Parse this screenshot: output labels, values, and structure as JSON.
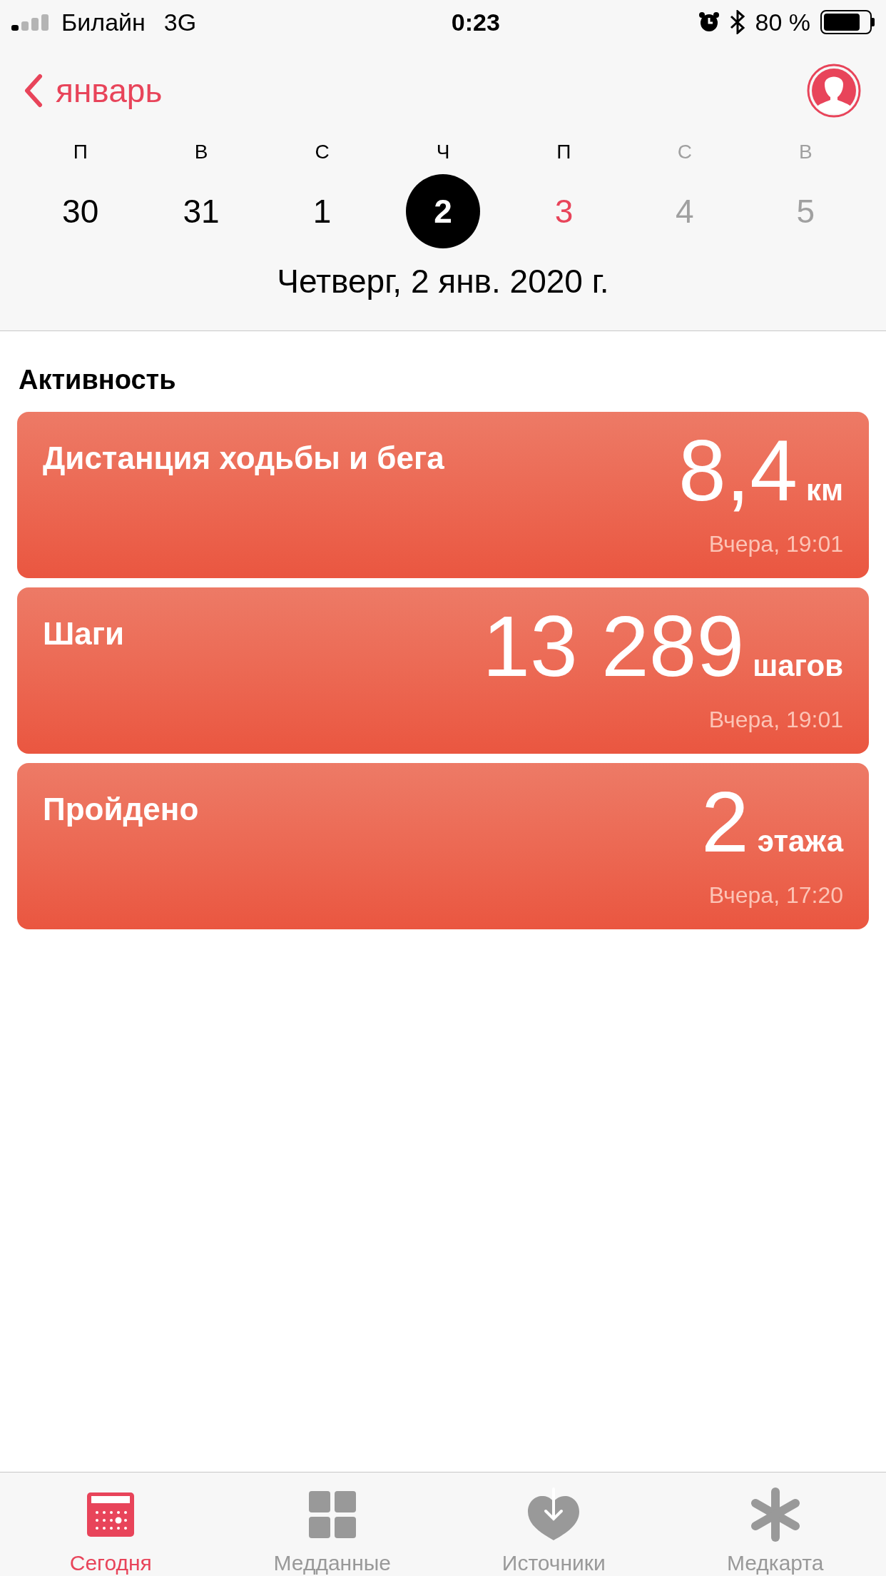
{
  "status_bar": {
    "carrier": "Билайн",
    "network": "3G",
    "time": "0:23",
    "battery_percent": "80 %"
  },
  "header": {
    "back_label": "январь"
  },
  "week": [
    {
      "weekday": "П",
      "day": "30",
      "selected": false,
      "today": false,
      "dimmed": false
    },
    {
      "weekday": "В",
      "day": "31",
      "selected": false,
      "today": false,
      "dimmed": false
    },
    {
      "weekday": "С",
      "day": "1",
      "selected": false,
      "today": false,
      "dimmed": false
    },
    {
      "weekday": "Ч",
      "day": "2",
      "selected": true,
      "today": false,
      "dimmed": false
    },
    {
      "weekday": "П",
      "day": "3",
      "selected": false,
      "today": true,
      "dimmed": false
    },
    {
      "weekday": "С",
      "day": "4",
      "selected": false,
      "today": false,
      "dimmed": true
    },
    {
      "weekday": "В",
      "day": "5",
      "selected": false,
      "today": false,
      "dimmed": true
    }
  ],
  "selected_date": "Четверг, 2 янв. 2020 г.",
  "section_title": "Активность",
  "cards": [
    {
      "title": "Дистанция ходьбы и бега",
      "value": "8,4",
      "unit": "км",
      "time": "Вчера, 19:01"
    },
    {
      "title": "Шаги",
      "value": "13 289",
      "unit": "шагов",
      "time": "Вчера, 19:01"
    },
    {
      "title": "Пройдено",
      "value": "2",
      "unit": "этажа",
      "time": "Вчера, 17:20"
    }
  ],
  "tabs": [
    {
      "label": "Сегодня",
      "selected": true
    },
    {
      "label": "Медданные",
      "selected": false
    },
    {
      "label": "Источники",
      "selected": false
    },
    {
      "label": "Медкарта",
      "selected": false
    }
  ]
}
